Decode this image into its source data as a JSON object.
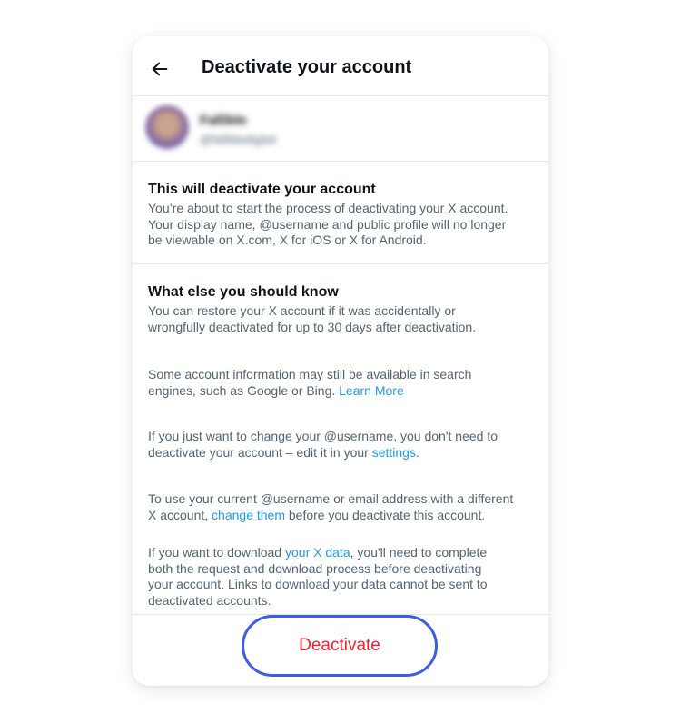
{
  "header": {
    "title": "Deactivate your account",
    "back_icon": "arrow-left-icon"
  },
  "account": {
    "name": "Fallible",
    "handle": "@fallibledigital"
  },
  "section_deactivate": {
    "heading": "This will deactivate your account",
    "lines": [
      "You’re about to start the process of deactivating your X account.",
      "Your display name, @username and public profile will no longer",
      "be viewable on X.com, X for iOS or X for Android."
    ]
  },
  "section_know": {
    "heading": "What else you should know",
    "p1": [
      "You can restore your X account if it was accidentally or",
      "wrongfully deactivated for up to 30 days after deactivation."
    ],
    "p2_line1": "Some account information may still be available in search",
    "p2_line2_pre": "engines, such as Google or Bing. ",
    "p2_link": "Learn More",
    "p3_line1": "If you just want to change your @username, you don't need to",
    "p3_line2_pre": "deactivate your account – edit it in your ",
    "p3_link": "settings",
    "p3_line2_post": ".",
    "p4_line1": "To use your current @username or email address with a different",
    "p4_line2_pre": "X account, ",
    "p4_link": "change them",
    "p4_line2_post": " before you deactivate this account.",
    "p5_line1_pre": "If you want to download ",
    "p5_link": "your X data",
    "p5_line1_post": ", you'll need to complete",
    "p5_lines": [
      "both the request and download process before deactivating",
      "your account. Links to download your data cannot be sent to",
      "deactivated accounts."
    ]
  },
  "footer": {
    "deactivate_label": "Deactivate"
  },
  "colors": {
    "link": "#1d9bf0",
    "danger": "#f4212e",
    "button_outline": "#3b5de7"
  }
}
